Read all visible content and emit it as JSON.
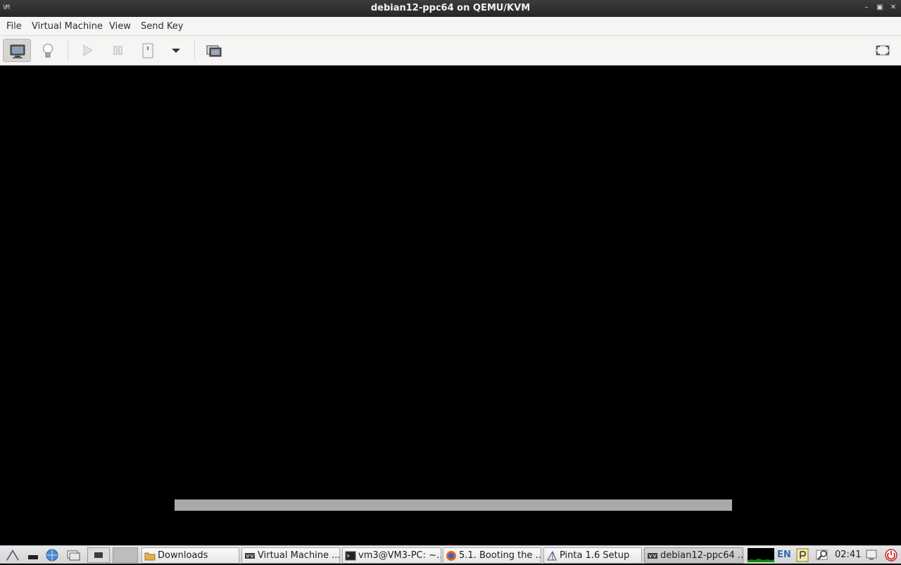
{
  "window": {
    "title": "debian12-ppc64 on QEMU/KVM",
    "app_icon_text": "VM"
  },
  "menubar": {
    "items": [
      "File",
      "Virtual Machine",
      "View",
      "Send Key"
    ]
  },
  "toolbar": {
    "buttons": [
      "console-view",
      "details-view",
      "run",
      "pause",
      "shutdown",
      "shutdown-menu",
      "snapshots",
      "fullscreen"
    ]
  },
  "vm_screen": {
    "progress_fraction": 1.0
  },
  "taskbar": {
    "tasks": [
      {
        "label": "Downloads",
        "icon": "folder-icon"
      },
      {
        "label": "Virtual Machine ...",
        "icon": "virt-manager-icon"
      },
      {
        "label": "vm3@VM3-PC: ~...",
        "icon": "terminal-icon"
      },
      {
        "label": "5.1. Booting the ...",
        "icon": "firefox-icon"
      },
      {
        "label": "Pinta 1.6 Setup",
        "icon": "pinta-icon"
      },
      {
        "label": "debian12-ppc64 ...",
        "icon": "virt-manager-icon"
      }
    ],
    "language": "EN",
    "clock": "02:41"
  },
  "colors": {
    "titlebar": "#2f2f2f",
    "menubar": "#f6f5f4",
    "screen": "#000000",
    "progress": "#a9a9a9"
  }
}
